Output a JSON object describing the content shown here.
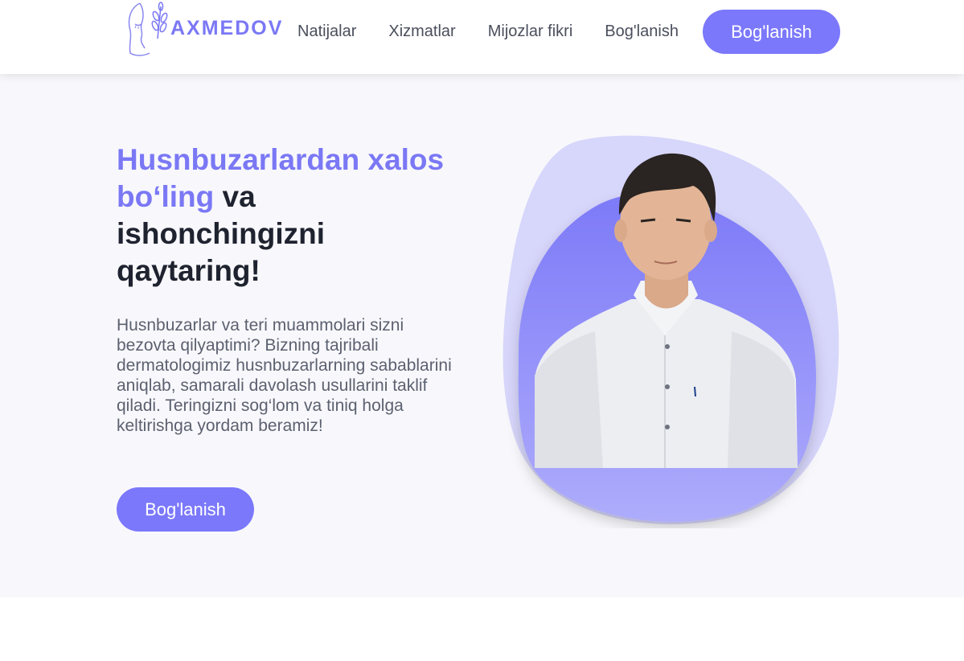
{
  "header": {
    "logo_text": "AXMEDOV",
    "nav": [
      "Natijalar",
      "Xizmatlar",
      "Mijozlar fikri",
      "Bog'lanish"
    ],
    "cta_label": "Bog'lanish"
  },
  "hero": {
    "headline_accent": "Husnbuzarlardan xalos bo‘ling",
    "headline_rest": " va ishonchingizni qaytaring!",
    "description": "Husnbuzarlar va teri muammolari sizni bezovta qilyaptimi? Bizning tajribali dermatologimiz husnbuzarlarning sabablarini aniqlab, samarali davolash usullarini taklif qiladi. Teringizni sog‘lom va tiniq holga keltirishga yordam beramiz!",
    "cta_label": "Bog'lanish"
  },
  "colors": {
    "accent": "#7b78fb",
    "blob_light": "#d7d6fb",
    "text_dark": "#1f2330",
    "hero_bg": "#f8f8fc"
  }
}
